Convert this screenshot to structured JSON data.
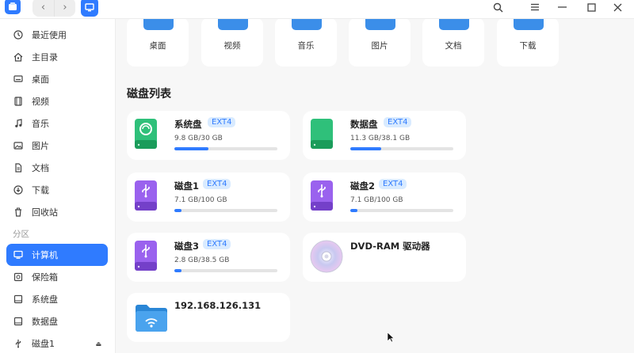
{
  "sidebar": {
    "items": [
      {
        "label": "最近使用",
        "icon": "clock-icon"
      },
      {
        "label": "主目录",
        "icon": "home-icon"
      },
      {
        "label": "桌面",
        "icon": "desktop-icon"
      },
      {
        "label": "视频",
        "icon": "film-icon"
      },
      {
        "label": "音乐",
        "icon": "music-icon"
      },
      {
        "label": "图片",
        "icon": "image-icon"
      },
      {
        "label": "文档",
        "icon": "document-icon"
      },
      {
        "label": "下载",
        "icon": "download-icon"
      },
      {
        "label": "回收站",
        "icon": "trash-icon"
      }
    ],
    "section_label": "分区",
    "devices": [
      {
        "label": "计算机",
        "icon": "computer-icon",
        "active": true
      },
      {
        "label": "保险箱",
        "icon": "vault-icon"
      },
      {
        "label": "系统盘",
        "icon": "drive-icon"
      },
      {
        "label": "数据盘",
        "icon": "drive-icon"
      },
      {
        "label": "磁盘1",
        "icon": "usb-icon",
        "eject": true
      }
    ]
  },
  "folders": [
    {
      "label": "桌面"
    },
    {
      "label": "视频"
    },
    {
      "label": "音乐"
    },
    {
      "label": "图片"
    },
    {
      "label": "文档"
    },
    {
      "label": "下载"
    }
  ],
  "disk_list_title": "磁盘列表",
  "disks": [
    {
      "name": "系统盘",
      "fs": "EXT4",
      "usage": "9.8 GB/30 GB",
      "fraction": 0.327,
      "icon": "system-disk-icon"
    },
    {
      "name": "数据盘",
      "fs": "EXT4",
      "usage": "11.3 GB/38.1 GB",
      "fraction": 0.297,
      "icon": "data-disk-icon"
    },
    {
      "name": "磁盘1",
      "fs": "EXT4",
      "usage": "7.1 GB/100 GB",
      "fraction": 0.071,
      "icon": "usb-disk-icon"
    },
    {
      "name": "磁盘2",
      "fs": "EXT4",
      "usage": "7.1 GB/100 GB",
      "fraction": 0.071,
      "icon": "usb-disk-icon"
    },
    {
      "name": "磁盘3",
      "fs": "EXT4",
      "usage": "2.8 GB/38.5 GB",
      "fraction": 0.073,
      "icon": "usb-disk-icon"
    },
    {
      "name": "DVD-RAM 驱动器",
      "icon": "optical-disc-icon"
    },
    {
      "name": "192.168.126.131",
      "icon": "network-folder-icon"
    }
  ],
  "colors": {
    "accent": "#2f7bff",
    "badge_bg": "#d9ebff",
    "system_disk": "#27b16a",
    "usb_disk": "#8d57e6",
    "folder": "#3b8ee9"
  }
}
